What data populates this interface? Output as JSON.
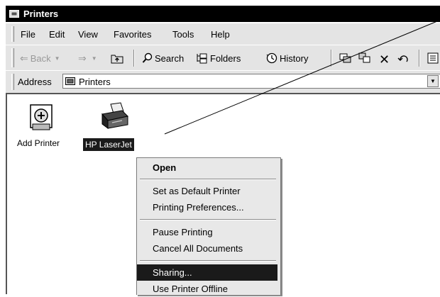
{
  "window": {
    "title": "Printers"
  },
  "menu": {
    "items": [
      "File",
      "Edit",
      "View",
      "Favorites",
      "Tools",
      "Help"
    ]
  },
  "toolbar": {
    "back": "Back",
    "search": "Search",
    "folders": "Folders",
    "history": "History"
  },
  "address": {
    "label": "Address",
    "value": "Printers"
  },
  "icons": {
    "add_printer": "Add Printer",
    "hp_laserjet": "HP LaserJet"
  },
  "context_menu": {
    "open": "Open",
    "set_default": "Set as Default Printer",
    "preferences": "Printing Preferences...",
    "pause": "Pause Printing",
    "cancel_all": "Cancel All Documents",
    "sharing": "Sharing...",
    "offline": "Use Printer Offline"
  }
}
